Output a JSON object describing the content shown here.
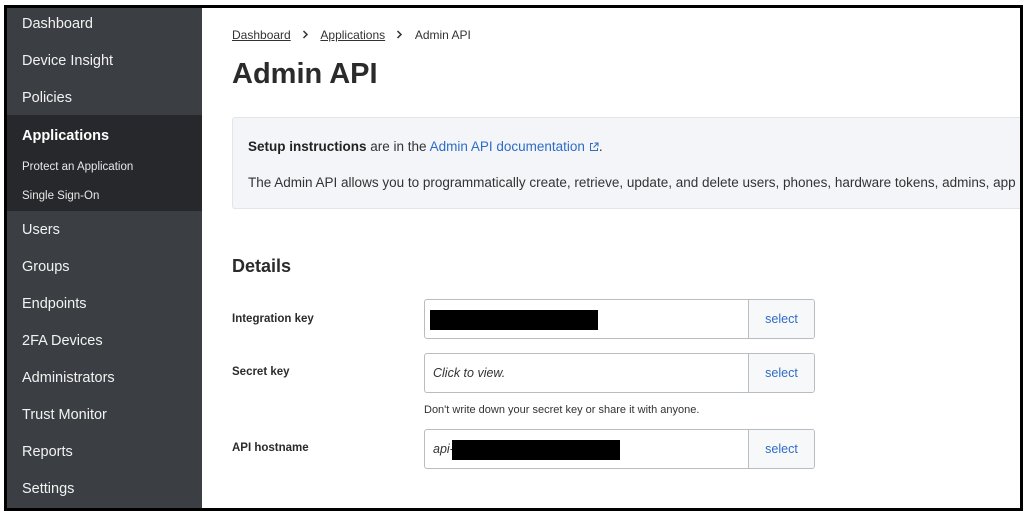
{
  "sidebar": {
    "items": [
      {
        "label": "Dashboard"
      },
      {
        "label": "Device Insight"
      },
      {
        "label": "Policies"
      },
      {
        "label": "Applications"
      },
      {
        "label": "Protect an Application"
      },
      {
        "label": "Single Sign-On"
      },
      {
        "label": "Users"
      },
      {
        "label": "Groups"
      },
      {
        "label": "Endpoints"
      },
      {
        "label": "2FA Devices"
      },
      {
        "label": "Administrators"
      },
      {
        "label": "Trust Monitor"
      },
      {
        "label": "Reports"
      },
      {
        "label": "Settings"
      }
    ],
    "active_index": 3
  },
  "breadcrumb": {
    "items": [
      "Dashboard",
      "Applications",
      "Admin API"
    ]
  },
  "page": {
    "title": "Admin API"
  },
  "info": {
    "setup_bold": "Setup instructions",
    "setup_text": " are in the ",
    "doc_link": "Admin API documentation",
    "period": ".",
    "description": "The Admin API allows you to programmatically create, retrieve, update, and delete users, phones, hardware tokens, admins, app"
  },
  "details": {
    "title": "Details",
    "fields": [
      {
        "label": "Integration key",
        "value": "",
        "button": "select"
      },
      {
        "label": "Secret key",
        "value": "Click to view.",
        "button": "select"
      },
      {
        "label": "API hostname",
        "value": "api-",
        "button": "select"
      }
    ],
    "secret_hint": "Don't write down your secret key or share it with anyone."
  },
  "colors": {
    "sidebar_bg": "#3b3e42",
    "sidebar_active_bg": "#26282b",
    "link": "#2e6cc8"
  },
  "icons": {
    "external_link": "external-link-icon",
    "chevron": "chevron-right-icon"
  }
}
